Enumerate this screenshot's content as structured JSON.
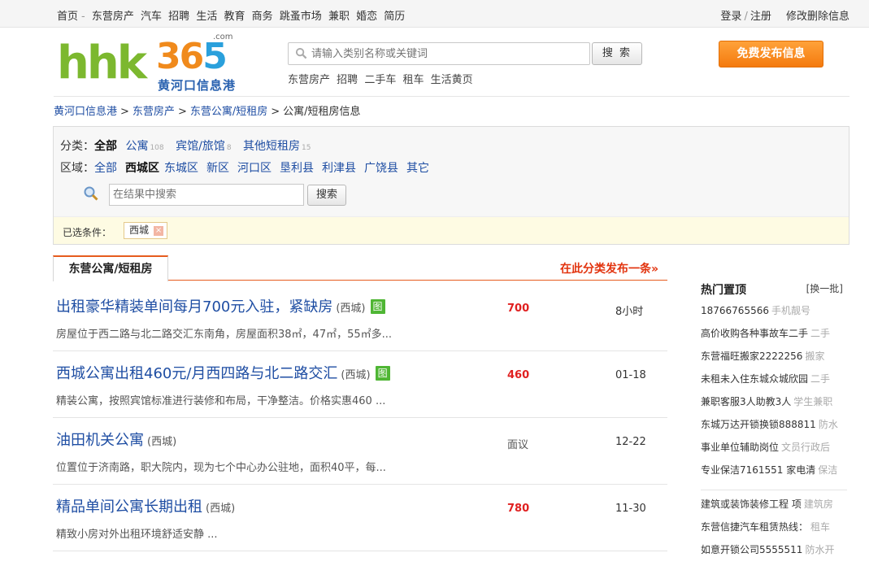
{
  "topbar": {
    "links": [
      "首页",
      "-",
      "东营房产",
      "汽车",
      "招聘",
      "生活",
      "教育",
      "商务",
      "跳蚤市场",
      "兼职",
      "婚恋",
      "简历"
    ],
    "login": "登录",
    "sep": "/",
    "register": "注册",
    "manage": "修改删除信息"
  },
  "logo": {
    "part1": "hhk",
    "part2a": "36",
    "part2b": "5",
    "com": ".com",
    "cn": "黄河口信息港"
  },
  "search": {
    "placeholder": "请输入类别名称或关键词",
    "button": "搜 索",
    "hotwords": [
      "东营房产",
      "招聘",
      "二手车",
      "租车",
      "生活黄页"
    ]
  },
  "publish_button": "免费发布信息",
  "breadcrumb": [
    "黄河口信息港",
    "东营房产",
    "东营公寓/短租房",
    "公寓/短租房信息"
  ],
  "filter": {
    "category_label": "分类：",
    "category_current": "全部",
    "categories": [
      {
        "name": "公寓",
        "count": "108"
      },
      {
        "name": "宾馆/旅馆",
        "count": "8"
      },
      {
        "name": "其他短租房",
        "count": "15"
      }
    ],
    "region_label": "区域：",
    "region_all": "全部",
    "region_current": "西城区",
    "regions": [
      "东城区",
      "新区",
      "河口区",
      "垦利县",
      "利津县",
      "广饶县",
      "其它"
    ],
    "search_placeholder": "在结果中搜索",
    "search_button": "搜索",
    "selected_label": "已选条件：",
    "selected_tag": "西城",
    "remove": "×"
  },
  "tab": {
    "label": "东营公寓/短租房",
    "post_link": "在此分类发布一条»"
  },
  "listings": [
    {
      "title": "出租豪华精装单间每月700元入驻，紧缺房",
      "area": "(西城)",
      "has_pic": true,
      "pic": "图",
      "desc": "房屋位于西二路与北二路交汇东南角，房屋面积38㎡，47㎡，55㎡多...",
      "price": "700",
      "time": "8小时"
    },
    {
      "title": "西城公寓出租460元/月西四路与北二路交汇",
      "area": "(西城)",
      "has_pic": true,
      "pic": "图",
      "desc": "精装公寓，按照宾馆标准进行装修和布局，干净整洁。价格实惠460 ...",
      "price": "460",
      "time": "01-18"
    },
    {
      "title": "油田机关公寓",
      "area": "(西城)",
      "has_pic": false,
      "pic": "",
      "desc": "位置位于济南路，职大院内，现为七个中心办公驻地，面积40平，每...",
      "price": "面议",
      "time": "12-22"
    },
    {
      "title": "精品单间公寓长期出租",
      "area": "(西城)",
      "has_pic": false,
      "pic": "",
      "desc": "精致小房对外出租环境舒适安静 ...",
      "price": "780",
      "time": "11-30"
    }
  ],
  "sidebar": {
    "title": "热门置顶",
    "change": "[换一批]",
    "items": [
      {
        "text": "18766765566",
        "cat": "手机靓号"
      },
      {
        "text": "高价收购各种事故车二手",
        "cat": "二手"
      },
      {
        "text": "东营福旺搬家2222256",
        "cat": "搬家"
      },
      {
        "text": "未租未入住东城众城欣园",
        "cat": "二手"
      },
      {
        "text": "兼职客服3人助教3人",
        "cat": "学生兼职"
      },
      {
        "text": "东城万达开锁换锁888811",
        "cat": "防水"
      },
      {
        "text": "事业单位辅助岗位",
        "cat": "文员行政后"
      },
      {
        "text": "专业保洁7161551 家电清",
        "cat": "保洁"
      }
    ],
    "items2": [
      {
        "text": "建筑或装饰装修工程 项",
        "cat": "建筑房"
      },
      {
        "text": "东营信捷汽车租赁热线：",
        "cat": "租车"
      },
      {
        "text": "如意开锁公司5555511",
        "cat": "防水开"
      }
    ]
  }
}
